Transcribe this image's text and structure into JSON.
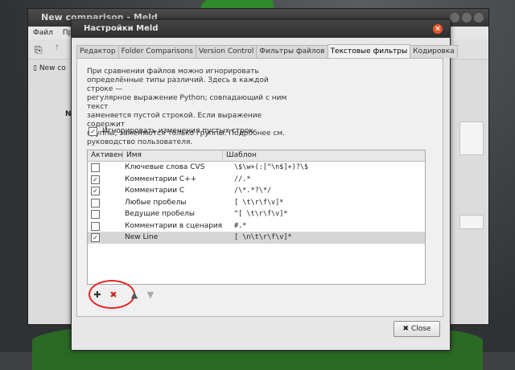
{
  "background_window": {
    "title": "New comparison - Meld",
    "menu": [
      "Файл",
      "Пр"
    ],
    "tab_label": "New co",
    "panel_label": "New"
  },
  "dialog": {
    "title": "Настройки Meld",
    "tabs": [
      "Редактор",
      "Folder Comparisons",
      "Version Control",
      "Фильтры файлов",
      "Текстовые фильтры",
      "Кодировка"
    ],
    "active_tab": "Текстовые фильтры",
    "description": [
      "При сравнении файлов можно игнорировать",
      "определённые типы различий. Здесь в каждой строке —",
      "регулярное выражение Python; совпадающий с ним текст",
      "заменяется пустой строкой. Если выражение содержит",
      "группы, заменяются только группы. Подробнее см.",
      "руководство пользователя."
    ],
    "ignore_blank_lines": {
      "label": "Игнорировать изменения пустых строк",
      "checked": true
    },
    "table": {
      "columns": [
        "Активен",
        "Имя",
        "Шаблон"
      ],
      "rows": [
        {
          "active": false,
          "name": "Ключевые слова CVS",
          "pattern": "\\$\\w+(:[^\\n$]+)?\\$"
        },
        {
          "active": true,
          "name": "Комментарии C++",
          "pattern": "//.*"
        },
        {
          "active": true,
          "name": "Комментарии C",
          "pattern": "/\\*.*?\\*/"
        },
        {
          "active": false,
          "name": "Любые пробелы",
          "pattern": "[ \\t\\r\\f\\v]*"
        },
        {
          "active": false,
          "name": "Ведущие пробелы",
          "pattern": "^[ \\t\\r\\f\\v]*"
        },
        {
          "active": false,
          "name": "Комментарии в сценариях",
          "pattern": "#.*"
        },
        {
          "active": true,
          "name": "New Line",
          "pattern": "[ \\n\\t\\r\\f\\v]*"
        }
      ],
      "selected_row": 6
    },
    "close_button": "Close",
    "accent_color": "#e42424"
  }
}
